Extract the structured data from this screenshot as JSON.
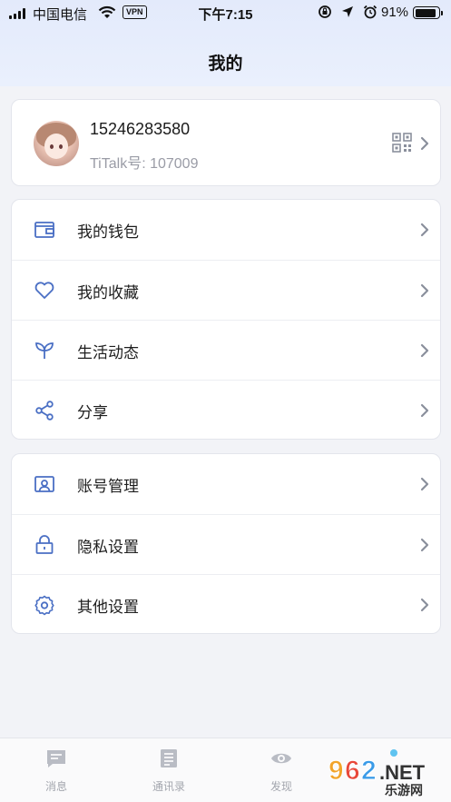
{
  "status_bar": {
    "carrier": "中国电信",
    "vpn": "VPN",
    "time": "下午7:15",
    "battery": "91%"
  },
  "header": {
    "title": "我的"
  },
  "profile": {
    "phone": "15246283580",
    "titalk_id": "TiTalk号: 107009"
  },
  "menu_group_1": [
    {
      "label": "我的钱包",
      "icon": "wallet-icon"
    },
    {
      "label": "我的收藏",
      "icon": "heart-icon"
    },
    {
      "label": "生活动态",
      "icon": "sprout-icon"
    },
    {
      "label": "分享",
      "icon": "share-icon"
    }
  ],
  "menu_group_2": [
    {
      "label": "账号管理",
      "icon": "id-card-icon"
    },
    {
      "label": "隐私设置",
      "icon": "lock-icon"
    },
    {
      "label": "其他设置",
      "icon": "gear-icon"
    }
  ],
  "tabbar": [
    {
      "label": "消息",
      "icon": "message-icon"
    },
    {
      "label": "通讯录",
      "icon": "contacts-icon"
    },
    {
      "label": "发现",
      "icon": "eye-icon"
    }
  ],
  "watermark": {
    "text": "962.NET",
    "subtext": "乐游网"
  },
  "colors": {
    "accent": "#3d67c8",
    "icon_blue": "#4a6fc4",
    "chevron": "#8a8f9c"
  }
}
